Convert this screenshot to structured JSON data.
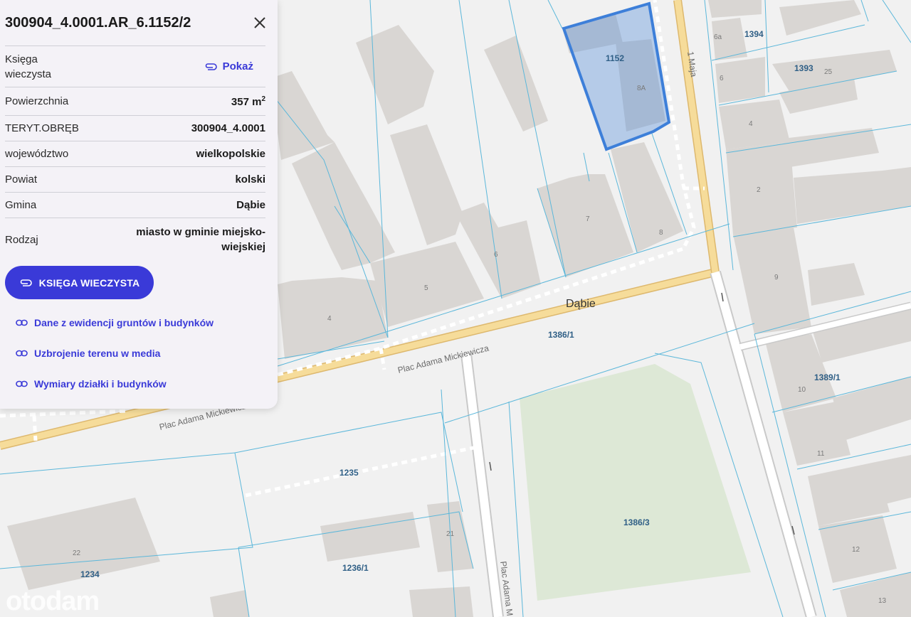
{
  "panel": {
    "title": "300904_4.0001.AR_6.1152/2",
    "rows": {
      "ksiega_label": "Księga wieczysta",
      "ksiega_action": "Pokaż",
      "powierzchnia_label": "Powierzchnia",
      "powierzchnia_value": "357 m",
      "powierzchnia_unit_sup": "2",
      "teryt_label": "TERYT.OBRĘB",
      "teryt_value": "300904_4.0001",
      "wojewodztwo_label": "województwo",
      "wojewodztwo_value": "wielkopolskie",
      "powiat_label": "Powiat",
      "powiat_value": "kolski",
      "gmina_label": "Gmina",
      "gmina_value": "Dąbie",
      "rodzaj_label": "Rodzaj",
      "rodzaj_value": "miasto w gminie miejsko-wiejskiej"
    },
    "primary_button": "KSIĘGA WIECZYSTA",
    "links": [
      "Dane z ewidencji gruntów i budynków",
      "Uzbrojenie terenu w media",
      "Wymiary działki i budynków"
    ],
    "accent_color": "#3a3ad8"
  },
  "map": {
    "place_name": "Dąbie",
    "streets": {
      "plac_1": "Plac Adama Mickiewicza",
      "plac_2": "Plac Adama Mickiewicza",
      "plac_3": "Plac Adama M",
      "maja": "1 Maja"
    },
    "parcels": {
      "p1152": "1152",
      "p1394": "1394",
      "p1393": "1393",
      "p1386_1": "1386/1",
      "p1389_1": "1389/1",
      "p1235": "1235",
      "p1386_3": "1386/3",
      "p1236_1": "1236/1",
      "p1234": "1234"
    },
    "house_numbers": {
      "h8A": "8A",
      "h6a": "6a",
      "h6": "6",
      "h25": "25",
      "h4r": "4",
      "h2": "2",
      "h7": "7",
      "h8": "8",
      "h6m": "6",
      "h5": "5",
      "h4l": "4",
      "h9": "9",
      "h10": "10",
      "h11": "11",
      "h12": "12",
      "h13": "13",
      "h21": "21",
      "h22": "22"
    },
    "selected_parcel_color": "#3d7fd9",
    "road_color": "#f6dc9a",
    "green_area_color": "#dde8d6"
  },
  "watermark": "otodam"
}
